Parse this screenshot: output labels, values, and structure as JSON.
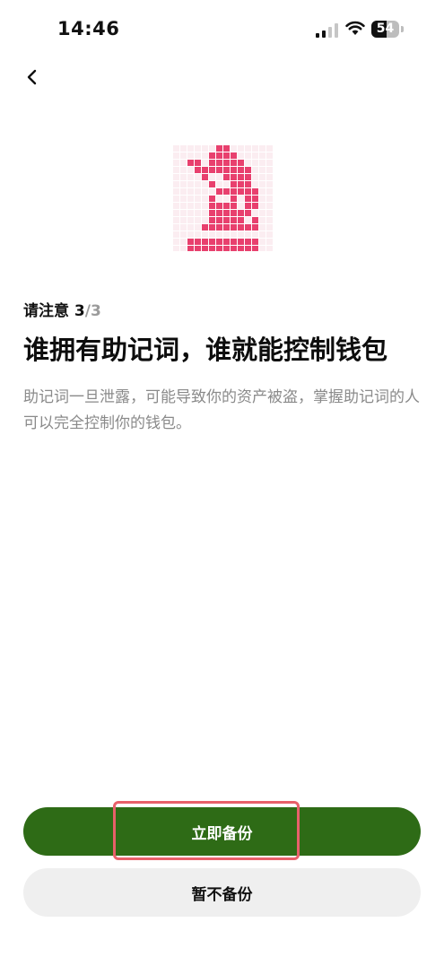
{
  "status_bar": {
    "time": "14:46",
    "battery_level": "54"
  },
  "icons": {
    "back": "chevron-left-icon",
    "illustration": "pixel-hand-icon",
    "signal": "signal-icon",
    "wifi": "wifi-icon",
    "battery": "battery-icon"
  },
  "notice": {
    "label": "请注意 3",
    "total": "/3"
  },
  "headline": "谁拥有助记词，谁就能控制钱包",
  "description": "助记词一旦泄露，可能导致你的资产被盗，掌握助记词的人可以完全控制你的钱包。",
  "actions": {
    "backup_now_label": "立即备份",
    "skip_backup_label": "暂不备份"
  },
  "colors": {
    "primary_button": "#2e6b16",
    "secondary_button": "#efefef",
    "illustration_pink": "#e8406e",
    "highlight_outline": "#e8606a"
  }
}
